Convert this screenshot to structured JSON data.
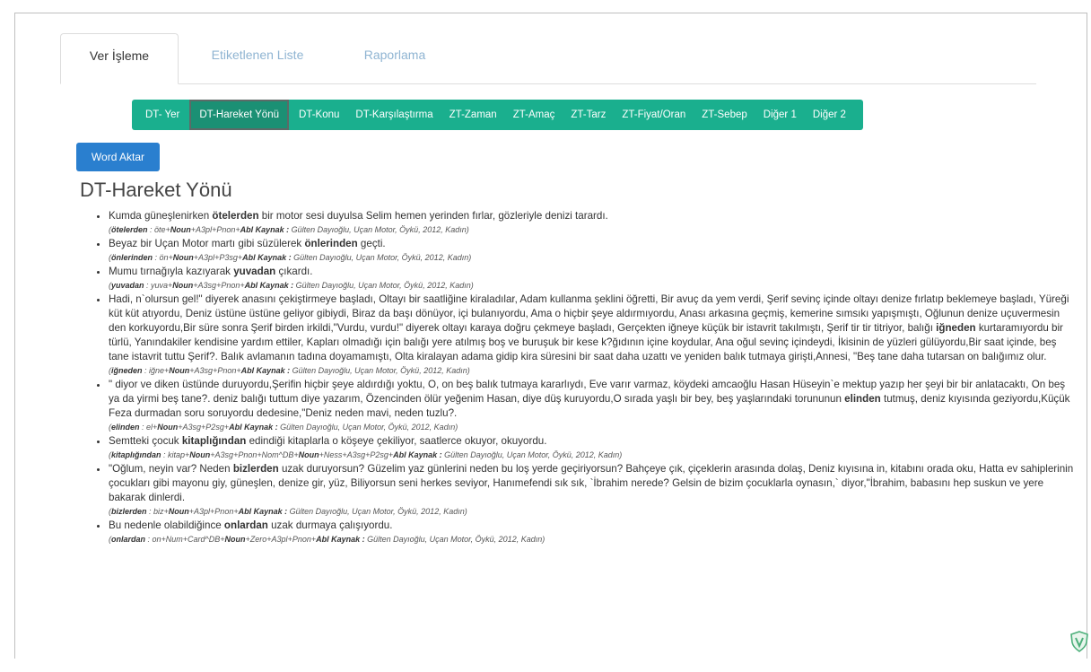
{
  "tabs": [
    {
      "label": "Ver İşleme"
    },
    {
      "label": "Etiketlenen Liste"
    },
    {
      "label": "Raporlama"
    }
  ],
  "categories": [
    "DT- Yer",
    "DT-Hareket Yönü",
    "DT-Konu",
    "DT-Karşılaştırma",
    "ZT-Zaman",
    "ZT-Amaç",
    "ZT-Tarz",
    "ZT-Fiyat/Oran",
    "ZT-Sebep",
    "Diğer 1",
    "Diğer 2"
  ],
  "word_button": "Word Aktar",
  "section_title": "DT-Hareket Yönü",
  "entries": [
    {
      "pre": "Kumda güneşlenirken ",
      "hl": "ötelerden",
      "post": " bir motor sesi duyulsa Selim hemen yerinden fırlar, gözleriyle denizi tarardı.",
      "m_word": "ötelerden",
      "m_a": " : öte+",
      "m_pos": "Noun",
      "m_b": "+A3pl+Pnon+",
      "m_case": "Abl Kaynak :",
      "m_src": " Gülten Dayıoğlu, Uçan Motor, Öykü, 2012, Kadın)"
    },
    {
      "pre": "Beyaz bir Uçan Motor martı gibi süzülerek ",
      "hl": "önlerinden",
      "post": " geçti.",
      "m_word": "önlerinden",
      "m_a": " : ön+",
      "m_pos": "Noun",
      "m_b": "+A3pl+P3sg+",
      "m_case": "Abl Kaynak :",
      "m_src": " Gülten Dayıoğlu, Uçan Motor, Öykü, 2012, Kadın)"
    },
    {
      "pre": "Mumu tırnağıyla kazıyarak ",
      "hl": "yuvadan",
      "post": " çıkardı.",
      "m_word": "yuvadan",
      "m_a": " : yuva+",
      "m_pos": "Noun",
      "m_b": "+A3sg+Pnon+",
      "m_case": "Abl Kaynak :",
      "m_src": " Gülten Dayıoğlu, Uçan Motor, Öykü, 2012, Kadın)"
    },
    {
      "pre": "Hadi, n`olursun gel!\" diyerek anasını çekiştirmeye başladı, Oltayı bir saatliğine kiraladılar, Adam kullanma şeklini öğretti, Bir avuç da yem verdi, Şerif sevinç içinde oltayı denize fırlatıp beklemeye başladı, Yüreği küt küt atıyordu, Deniz üstüne üstüne geliyor gibiydi, Biraz da başı dönüyor, içi bulanıyordu, Ama o hiçbir şeye aldırmıyordu, Anası arkasına geçmiş, kemerine sımsıkı yapışmıştı, Oğlunun denize uçuvermesin den korkuyordu,Bir süre sonra Şerif birden irkildi,\"Vurdu, vurdu!\" diyerek oltayı karaya doğru çekmeye başladı, Gerçekten iğneye küçük bir istavrit takılmıştı, Şerif tir tir titriyor, balığı ",
      "hl": "iğneden",
      "post": " kurtaramıyordu bir türlü, Yanındakiler kendisine yardım ettiler, Kapları olmadığı için balığı yere atılmış boş ve buruşuk bir kese k?ğıdının içine koydular, Ana oğul sevinç içindeydi, İkisinin de yüzleri gülüyordu,Bir saat içinde, beş tane istavrit tuttu Şerif?. Balık avlamanın tadına doyamamıştı, Olta kiralayan adama gidip kira süresini bir saat daha uzattı ve yeniden balık tutmaya girişti,Annesi, \"Beş tane daha tutarsan on balığımız olur.",
      "m_word": "iğneden",
      "m_a": " : iğne+",
      "m_pos": "Noun",
      "m_b": "+A3sg+Pnon+",
      "m_case": "Abl Kaynak :",
      "m_src": " Gülten Dayıoğlu, Uçan Motor, Öykü, 2012, Kadın)"
    },
    {
      "pre": "\" diyor ve diken üstünde duruyordu,Şerifin hiçbir şeye aldırdığı yoktu, O, on beş balık tutmaya kararlıydı, Eve varır varmaz, köydeki amcaoğlu Hasan Hüseyin`e mektup yazıp her şeyi bir bir anlatacaktı, On beş ya da yirmi beş tane?. deniz balığı tuttum diye yazarım, Özencinden ölür yeğenim Hasan, diye düş kuruyordu,O sırada yaşlı bir bey, beş yaşlarındaki torununun ",
      "hl": "elinden",
      "post": " tutmuş, deniz kıyısında geziyordu,Küçük Feza durmadan soru soruyordu dedesine,\"Deniz neden mavi, neden tuzlu?.",
      "m_word": "elinden",
      "m_a": " : el+",
      "m_pos": "Noun",
      "m_b": "+A3sg+P2sg+",
      "m_case": "Abl Kaynak :",
      "m_src": " Gülten Dayıoğlu, Uçan Motor, Öykü, 2012, Kadın)"
    },
    {
      "pre": "Semtteki çocuk ",
      "hl": "kitaplığından",
      "post": " edindiği kitaplarla o köşeye çekiliyor, saatlerce okuyor, okuyordu.",
      "m_word": "kitaplığından",
      "m_a": " : kitap+",
      "m_pos": "Noun",
      "m_b": "+A3sg+Pnon+Nom^DB+",
      "m_pos2": "Noun",
      "m_b2": "+Ness+A3sg+P2sg+",
      "m_case": "Abl Kaynak :",
      "m_src": " Gülten Dayıoğlu, Uçan Motor, Öykü, 2012, Kadın)"
    },
    {
      "pre": "\"Oğlum, neyin var? Neden ",
      "hl": "bizlerden",
      "post": " uzak duruyorsun? Güzelim yaz günlerini neden bu loş yerde geçiriyorsun? Bahçeye çık, çiçeklerin arasında dolaş, Deniz kıyısına in, kitabını orada oku, Hatta ev sahiplerinin çocukları gibi mayonu giy, güneşlen, denize gir, yüz, Biliyorsun seni herkes seviyor, Hanımefendi sık sık, `İbrahim nerede? Gelsin de bizim çocuklarla oynasın,` diyor,\"İbrahim, babasını hep suskun ve yere bakarak dinlerdi.",
      "m_word": "bizlerden",
      "m_a": " : biz+",
      "m_pos": "Noun",
      "m_b": "+A3pl+Pnon+",
      "m_case": "Abl Kaynak :",
      "m_src": " Gülten Dayıoğlu, Uçan Motor, Öykü, 2012, Kadın)"
    },
    {
      "pre": "Bu nedenle olabildiğince ",
      "hl": "onlardan",
      "post": " uzak durmaya çalışıyordu.",
      "m_word": "onlardan",
      "m_a": " : on+Num+Card^DB+",
      "m_pos": "Noun",
      "m_b": "+Zero+A3pl+Pnon+",
      "m_case": "Abl Kaynak :",
      "m_src": " Gülten Dayıoğlu, Uçan Motor, Öykü, 2012, Kadın)"
    }
  ]
}
